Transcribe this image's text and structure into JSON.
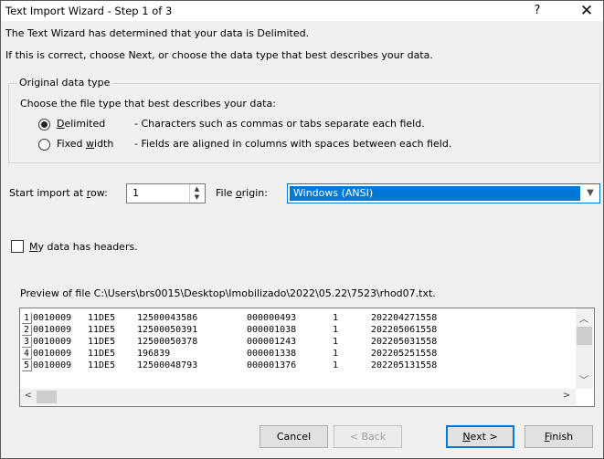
{
  "window": {
    "title": "Text Import Wizard - Step 1 of 3",
    "help_glyph": "?",
    "close_glyph": "✕"
  },
  "intro": {
    "line1": "The Text Wizard has determined that your data is Delimited.",
    "line2": "If this is correct, choose Next, or choose the data type that best describes your data."
  },
  "original_data_type": {
    "title": "Original data type",
    "prompt": "Choose the file type that best describes your data:",
    "options": [
      {
        "key": "D",
        "label_rest": "elimited",
        "description": "- Characters such as commas or tabs separate each field.",
        "selected": true
      },
      {
        "key_prefix": "Fixed ",
        "key": "w",
        "label_rest": "idth",
        "description": "- Fields are aligned in columns with spaces between each field.",
        "selected": false
      }
    ]
  },
  "import_settings": {
    "start_row_prefix": "Start import at ",
    "start_row_key": "r",
    "start_row_suffix": "ow:",
    "start_row_value": "1",
    "file_origin_prefix": "File ",
    "file_origin_key": "o",
    "file_origin_suffix": "rigin:",
    "file_origin_value": "Windows (ANSI)"
  },
  "headers_option": {
    "key": "M",
    "label_rest": "y data has headers.",
    "checked": false
  },
  "preview": {
    "label": "Preview of file C:\\Users\\brs0015\\Desktop\\Imobilizado\\2022\\05.22\\7523\\rhod07.txt.",
    "rows": [
      {
        "num": "1",
        "c1": "0010009",
        "c2": "11DE5",
        "c3": "12500043586",
        "c4": "000000493",
        "c5": "1",
        "c6": "202204271558"
      },
      {
        "num": "2",
        "c1": "0010009",
        "c2": "11DE5",
        "c3": "12500050391",
        "c4": "000001038",
        "c5": "1",
        "c6": "202205061558"
      },
      {
        "num": "3",
        "c1": "0010009",
        "c2": "11DE5",
        "c3": "12500050378",
        "c4": "000001243",
        "c5": "1",
        "c6": "202205031558"
      },
      {
        "num": "4",
        "c1": "0010009",
        "c2": "11DE5",
        "c3": "196839",
        "c4": "000001338",
        "c5": "1",
        "c6": "202205251558"
      },
      {
        "num": "5",
        "c1": "0010009",
        "c2": "11DE5",
        "c3": "12500048793",
        "c4": "000001376",
        "c5": "1",
        "c6": "202205131558"
      }
    ]
  },
  "buttons": {
    "cancel": "Cancel",
    "back": "< Back",
    "next_key": "N",
    "next_rest": "ext >",
    "finish_key": "F",
    "finish_rest": "inish"
  },
  "icons": {
    "scroll_up": "chevron-up-icon",
    "scroll_down": "chevron-down-icon",
    "scroll_left": "chevron-left-icon",
    "scroll_right": "chevron-right-icon",
    "dropdown": "chevron-down-icon"
  },
  "colors": {
    "accent": "#0078d7",
    "dialog_bg": "#f0f0f0"
  }
}
